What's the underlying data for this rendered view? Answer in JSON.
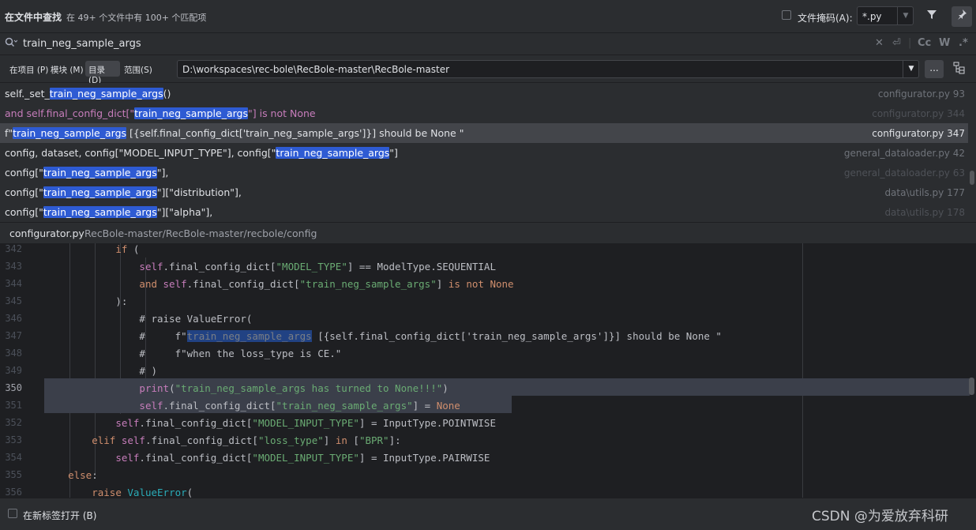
{
  "header": {
    "title": "在文件中查找",
    "subtitle": "在 49+ 个文件中有 100+ 个匹配项",
    "file_mask_label": "文件掩码(A):",
    "file_mask_value": "*.py",
    "file_mask_checked": false,
    "filter_icon": "filter-icon",
    "pin_icon": "pin-icon"
  },
  "search": {
    "query": "train_neg_sample_args",
    "options": [
      "Cc",
      "W",
      ".*"
    ]
  },
  "scope": {
    "tabs": [
      "在项目 (P)",
      "模块 (M)",
      "目录 (D)",
      "范围(S)"
    ],
    "active_tab": "目录 (D)",
    "directory": "D:\\workspaces\\rec-bole\\RecBole-master\\RecBole-master",
    "browse_label": "..."
  },
  "results": [
    {
      "pre": "self._set_",
      "match": "train_neg_sample_args",
      "post": "()",
      "location": "configurator.py 93"
    },
    {
      "pre": "and self.final_config_dict[\"",
      "match": "train_neg_sample_args",
      "post": "\"] is not None",
      "location": "configurator.py 344"
    },
    {
      "pre": "f\"",
      "match": "train_neg_sample_args",
      "post": " [{self.final_config_dict['train_neg_sample_args']}] should be None \"",
      "location": "configurator.py 347"
    },
    {
      "pre": "config, dataset, config[\"MODEL_INPUT_TYPE\"], config[\"",
      "match": "train_neg_sample_args",
      "post": "\"]",
      "location": "general_dataloader.py 42"
    },
    {
      "pre": "config[\"",
      "match": "train_neg_sample_args",
      "post": "\"],",
      "location": "general_dataloader.py 63"
    },
    {
      "pre": "config[\"",
      "match": "train_neg_sample_args",
      "post": "\"][\"distribution\"],",
      "location": "data\\utils.py 177"
    },
    {
      "pre": "config[\"",
      "match": "train_neg_sample_args",
      "post": "\"][\"alpha\"],",
      "location": "data\\utils.py 178"
    }
  ],
  "file_bar": {
    "file_name": "configurator.py",
    "file_path": "RecBole-master/RecBole-master/recbole/config"
  },
  "editor": {
    "lines": [
      {
        "num": "342",
        "indent": "            ",
        "code": "if ("
      },
      {
        "num": "343",
        "indent": "                ",
        "code": "self.final_config_dict[\"MODEL_TYPE\"] == ModelType.SEQUENTIAL"
      },
      {
        "num": "344",
        "indent": "                ",
        "code": "and self.final_config_dict[\"train_neg_sample_args\"] is not None"
      },
      {
        "num": "345",
        "indent": "            ",
        "code": "):"
      },
      {
        "num": "346",
        "indent": "                ",
        "code": "# raise ValueError("
      },
      {
        "num": "347",
        "indent": "                ",
        "code": "#     f\"train_neg_sample_args [{self.final_config_dict['train_neg_sample_args']}] should be None \""
      },
      {
        "num": "348",
        "indent": "                ",
        "code": "#     f\"when the loss_type is CE.\""
      },
      {
        "num": "349",
        "indent": "                ",
        "code": "# )"
      },
      {
        "num": "350",
        "indent": "                ",
        "code": "print(\"train_neg_sample_args has turned to None!!!\")"
      },
      {
        "num": "351",
        "indent": "                ",
        "code": "self.final_config_dict[\"train_neg_sample_args\"] = None"
      },
      {
        "num": "352",
        "indent": "            ",
        "code": "self.final_config_dict[\"MODEL_INPUT_TYPE\"] = InputType.POINTWISE"
      },
      {
        "num": "353",
        "indent": "        ",
        "code": "elif self.final_config_dict[\"loss_type\"] in [\"BPR\"]:"
      },
      {
        "num": "354",
        "indent": "            ",
        "code": "self.final_config_dict[\"MODEL_INPUT_TYPE\"] = InputType.PAIRWISE"
      },
      {
        "num": "355",
        "indent": "    ",
        "code": "else:"
      },
      {
        "num": "356",
        "indent": "        ",
        "code": "raise ValueError("
      }
    ]
  },
  "footer": {
    "open_new_tab_label": "在新标签打开 (B)",
    "open_new_tab_checked": false,
    "watermark": "CSDN @为爱放弃科研"
  },
  "colors": {
    "match_highlight": "#2e5bd3",
    "selected_row": "#43454a",
    "editor_bg": "#1e1f22",
    "panel_bg": "#2b2d30"
  }
}
